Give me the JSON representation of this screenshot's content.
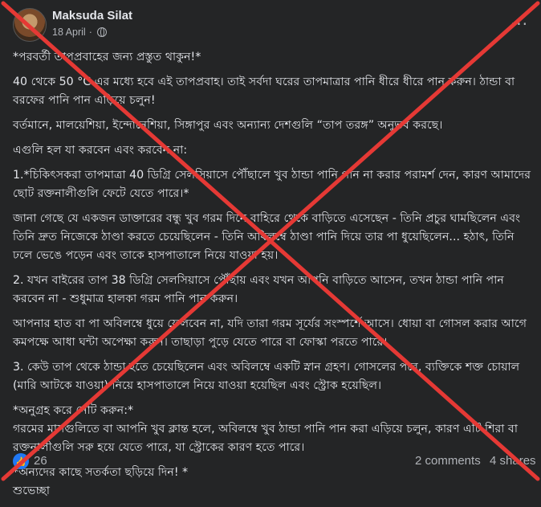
{
  "post": {
    "author": "Maksuda Silat",
    "date": "18 April",
    "dot": "·",
    "menu_icon": "more-icon",
    "paragraphs": [
      "*পরবর্তী তাপপ্রবাহের জন্য প্রস্তুত থাকুন!*",
      "40 থেকে 50 °C এর মধ্যে হবে এই তাপপ্রবাহ। তাই সর্বদা ঘরের তাপমাত্রার পানি ধীরে ধীরে পান করুন। ঠান্ডা বা বরফের পানি পান এড়িয়ে চলুন!",
      "বর্তমানে, মালয়েশিয়া, ইন্দোনেশিয়া, সিঙ্গাপুর এবং অন্যান্য দেশগুলি “তাপ তরঙ্গ” অনুভব করছে।",
      "এগুলি হল যা করবেন এবং করবেন না:",
      "1.*চিকিৎসকরা তাপমাত্রা 40 ডিগ্রি সেলসিয়াসে পৌঁছালে খুব ঠান্ডা পানি পান না করার পরামর্শ দেন, কারণ আমাদের ছোট রক্তনালীগুলি ফেটে যেতে পারে।*",
      "জানা গেছে যে একজন ডাক্তারের বন্ধু খুব গরম দিনে বাহিরে থেকে বাড়িতে এসেছেন - তিনি প্রচুর ঘামছিলেন এবং তিনি দ্রুত নিজেকে ঠাণ্ডা করতে চেয়েছিলেন - তিনি অবিলম্বে ঠাণ্ডা পানি দিয়ে তার পা ধুয়েছিলেন... হঠাৎ, তিনি ঢলে ভেঙে পড়েন এবং তাকে হাসপাতালে নিয়ে যাওয়া হয়।",
      " 2. যখন বাইরের তাপ 38 ডিগ্রি সেলসিয়াসে পৌঁছায় এবং যখন আপনি বাড়িতে আসেন, তখন ঠান্ডা পানি পান করবেন না - শুধুমাত্র হালকা গরম পানি পান করুন।",
      "আপনার হাত বা পা অবিলম্বে ধুয়ে ফেলবেন না, যদি তারা গরম সূর্যের সংস্পর্শে আসে। ধোয়া বা গোসল করার আগে কমপক্ষে আধা ঘন্টা অপেক্ষা করুন। তাছাড়া পুড়ে যেতে পারে বা ফোস্কা পরতে পারে।",
      " 3. কেউ তাপ থেকে ঠান্ডা হতে চেয়েছিলেন এবং অবিলম্বে একটি স্নান গ্রহণ। গোসলের পরে, ব্যক্তিকে শক্ত চোয়াল (মারি আটকে যাওয়া) নিয়ে হাসপাতালে নিয়ে যাওয়া হয়েছিল এবং স্ট্রোক হয়েছিল।",
      "*অনুগ্রহ করে নোট করুন:*\nগরমের মাসগুলিতে বা আপনি খুব ক্লান্ত হলে, অবিলম্বে খুব ঠান্ডা পানি পান করা এড়িয়ে চলুন, কারণ এটি শিরা বা রক্তনালীগুলি সরু হয়ে যেতে পারে, যা স্ট্রোকের কারণ হতে পারে।",
      "*অন্যদের কাছে সতর্কতা ছড়িয়ে দিন! *\nশুভেচ্ছা"
    ]
  },
  "footer": {
    "like_icon": "like-icon",
    "like_count": "26",
    "comments": "2 comments",
    "shares": "4 shares"
  },
  "overlay": {
    "type": "red-x-cross",
    "color": "#e53935"
  }
}
